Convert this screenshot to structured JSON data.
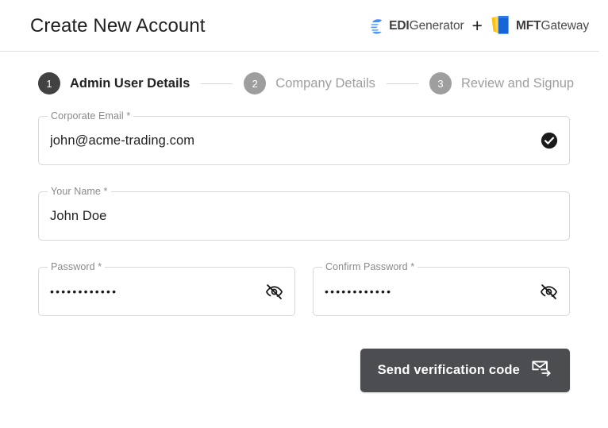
{
  "header": {
    "title": "Create New Account",
    "brands": {
      "edi": {
        "icon": "edi-generator-logo-icon",
        "bold": "EDI",
        "light": "Generator"
      },
      "separator": "+",
      "mft": {
        "icon": "mft-gateway-logo-icon",
        "bold": "MFT",
        "light": "Gateway"
      }
    }
  },
  "stepper": {
    "steps": [
      {
        "number": "1",
        "label": "Admin User Details",
        "state": "active"
      },
      {
        "number": "2",
        "label": "Company Details",
        "state": "inactive"
      },
      {
        "number": "3",
        "label": "Review and Signup",
        "state": "inactive"
      }
    ]
  },
  "form": {
    "email": {
      "label": "Corporate Email *",
      "value": "john@acme-trading.com",
      "placeholder": "",
      "suffix_icon": "verified-check-icon"
    },
    "name": {
      "label": "Your Name *",
      "value": "John Doe",
      "placeholder": ""
    },
    "password": {
      "label": "Password *",
      "value": "••••••••••••",
      "placeholder": "",
      "suffix_icon": "visibility-off-icon"
    },
    "confirm_password": {
      "label": "Confirm Password *",
      "value": "••••••••••••",
      "placeholder": "",
      "suffix_icon": "visibility-off-icon"
    }
  },
  "actions": {
    "submit_label": "Send verification code",
    "submit_icon": "send-email-icon"
  },
  "colors": {
    "active_step": "#424242",
    "inactive_step": "#9e9e9e",
    "button_bg": "#4b4d50",
    "edi_blue": "#3f8efc",
    "mft_yellow": "#ffc107",
    "mft_blue": "#1565d8",
    "field_border": "#d8d8d8"
  }
}
